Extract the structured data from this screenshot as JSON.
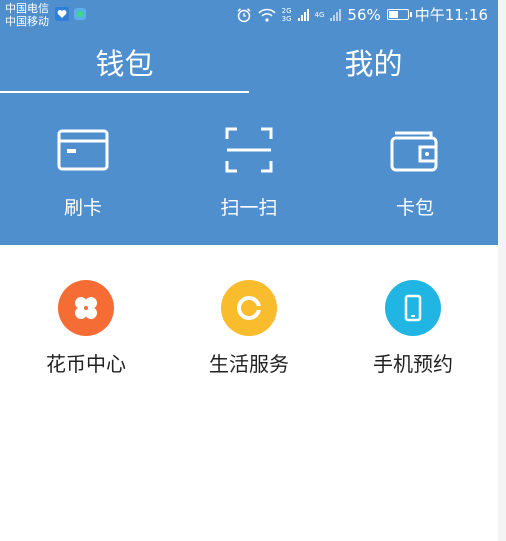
{
  "status_bar": {
    "carrier_1": "中国电信",
    "carrier_2": "中国移动",
    "net_top": "2G",
    "net_bottom": "3G",
    "net_4g": "4G",
    "battery_percent": "56%",
    "battery_level": 0.56,
    "time": "中午11:16"
  },
  "tabs": [
    {
      "label": "钱包",
      "active": true
    },
    {
      "label": "我的",
      "active": false
    }
  ],
  "actions": [
    {
      "label": "刷卡",
      "icon": "credit-card-icon"
    },
    {
      "label": "扫一扫",
      "icon": "scan-icon"
    },
    {
      "label": "卡包",
      "icon": "wallet-icon"
    }
  ],
  "services": [
    {
      "label": "花币中心",
      "icon": "flower-icon",
      "color": "#f56c35"
    },
    {
      "label": "生活服务",
      "icon": "life-service-icon",
      "color": "#f8bc2c"
    },
    {
      "label": "手机预约",
      "icon": "phone-icon",
      "color": "#21b5e4"
    }
  ],
  "colors": {
    "header_blue": "#4f8fce"
  }
}
